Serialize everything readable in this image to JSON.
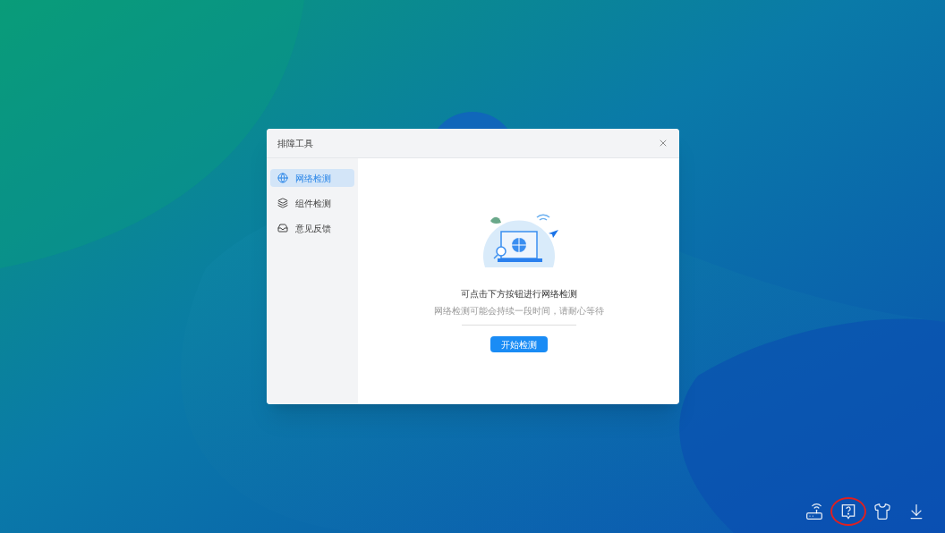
{
  "dialog": {
    "title": "排障工具"
  },
  "sidebar": {
    "items": [
      {
        "label": "网络检测",
        "kind": "globe",
        "selected": true
      },
      {
        "label": "组件检测",
        "kind": "layers",
        "selected": false
      },
      {
        "label": "意见反馈",
        "kind": "inbox",
        "selected": false
      }
    ]
  },
  "main": {
    "heading": "可点击下方按钮进行网络检测",
    "note": "网络检测可能会持续一段时间，请耐心等待",
    "button": "开始检测"
  },
  "tray": {
    "items": [
      {
        "kind": "router",
        "highlighted": false
      },
      {
        "kind": "help",
        "highlighted": true
      },
      {
        "kind": "shirt",
        "highlighted": false
      },
      {
        "kind": "download",
        "highlighted": false
      }
    ]
  }
}
